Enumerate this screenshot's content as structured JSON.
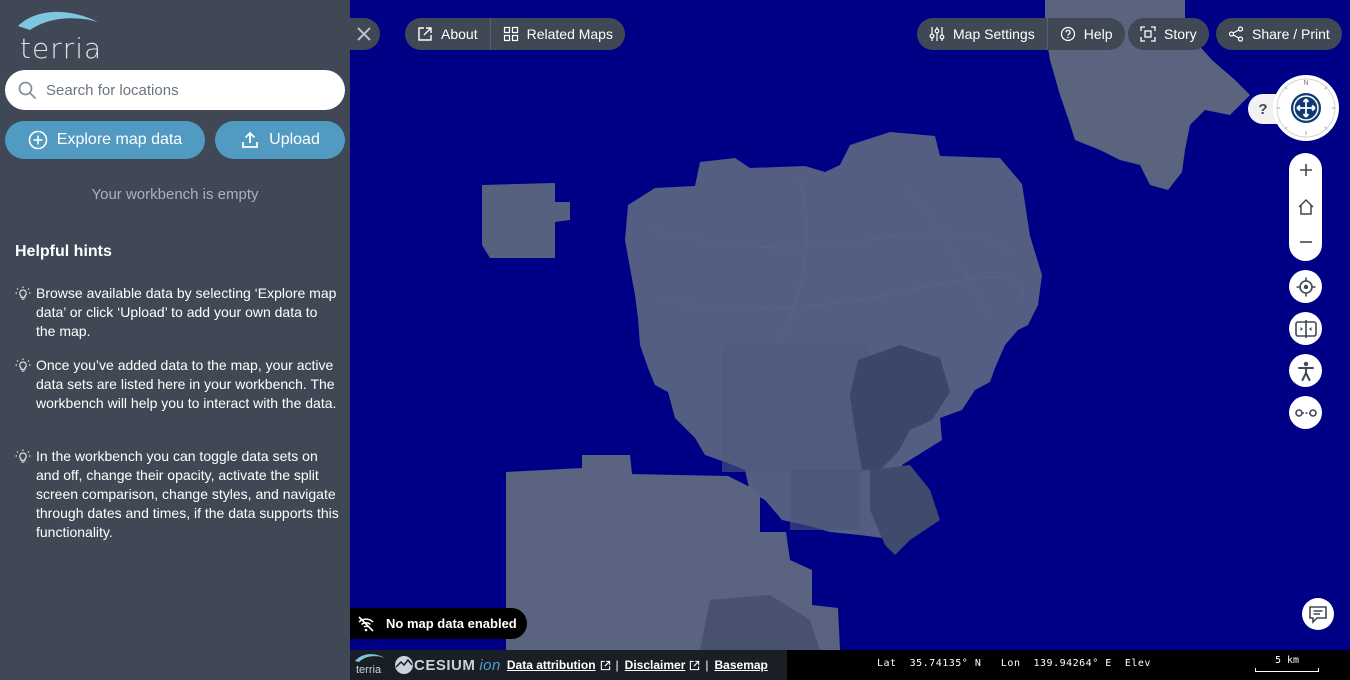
{
  "sidebar": {
    "logo_text": "terria",
    "search": {
      "placeholder": "Search for locations",
      "value": ""
    },
    "explore_button": "Explore map data",
    "upload_button": "Upload",
    "workbench_empty": "Your workbench is empty",
    "hints_title": "Helpful hints",
    "hints": [
      "Browse available data by selecting ‘Explore map data’ or click ‘Upload’ to add your own data to the map.",
      "Once you’ve added data to the map, your active data sets are listed here in your workbench. The workbench will help you to interact with the data.",
      "In the workbench you can toggle data sets on and off, change their opacity, activate the split screen comparison, change styles, and navigate through dates and times, if the data supports this functionality."
    ]
  },
  "toolbar": {
    "about": "About",
    "related_maps": "Related Maps",
    "map_settings": "Map Settings",
    "help": "Help",
    "story": "Story",
    "share": "Share / Print"
  },
  "map_controls": {
    "compass_help": "?",
    "compass_north": "N"
  },
  "status": {
    "no_map_data": "No map data enabled"
  },
  "bottom_bar": {
    "terria_mini": "terria",
    "cesium": "CESIUM",
    "cesium_ion": "ion",
    "data_attribution": "Data attribution",
    "disclaimer": "Disclaimer",
    "basemap": "Basemap",
    "separator": "|",
    "lat_label": "Lat",
    "lat_value": "35.74135° N",
    "lon_label": "Lon",
    "lon_value": "139.94264° E",
    "elev_label": "Elev",
    "scale": "5 km"
  },
  "colors": {
    "sidebar_bg": "#3f4854",
    "accent": "#519ac2",
    "ocean": "#000087",
    "land": "#535c80"
  },
  "icons": {
    "search": "search-icon",
    "explore": "plus-circle-icon",
    "upload": "upload-icon",
    "hint": "lightbulb-icon",
    "close": "close-icon",
    "about": "external-link-icon",
    "related": "grid-icon",
    "settings": "sliders-icon",
    "help": "question-circle-icon",
    "story": "story-icon",
    "share": "share-icon"
  }
}
